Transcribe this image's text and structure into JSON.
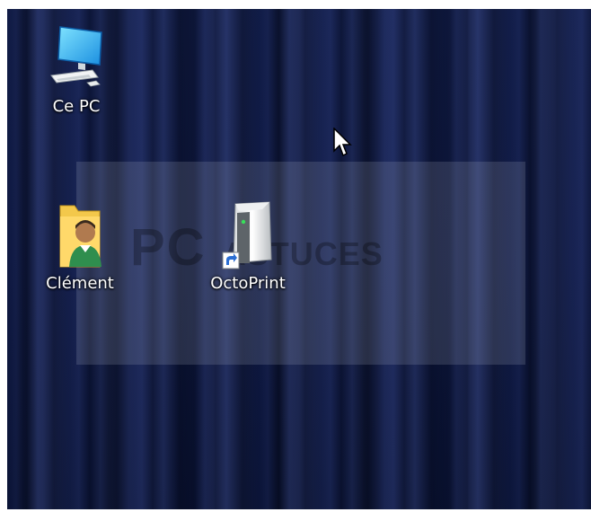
{
  "desktop": {
    "icons": [
      {
        "label": "Ce PC",
        "icon": "computer-icon"
      },
      {
        "label": "Clément",
        "icon": "user-folder-icon"
      },
      {
        "label": "OctoPrint",
        "icon": "server-shortcut-icon"
      }
    ],
    "watermark": {
      "text_main": "PC",
      "text_sub": "ASTUCES"
    }
  }
}
